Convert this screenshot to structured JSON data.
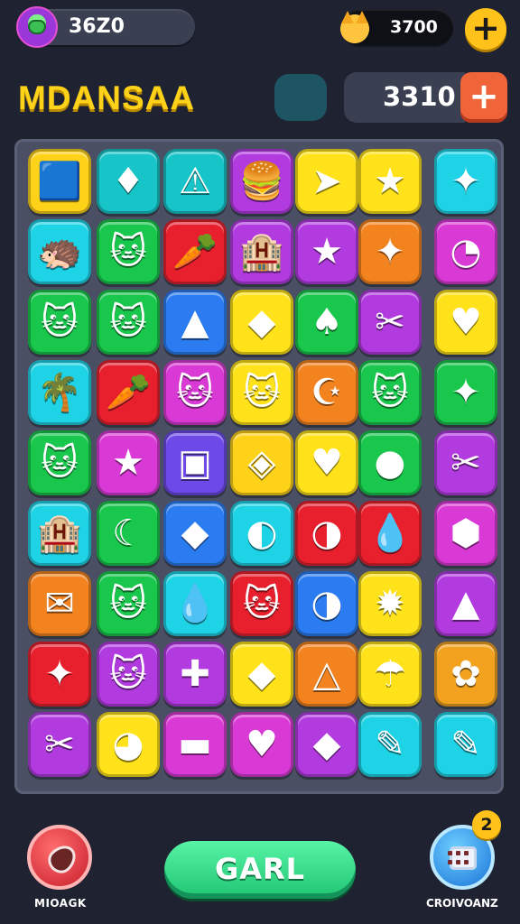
{
  "top_bar": {
    "coins": "36Z0",
    "gems": "3700",
    "avatar_icon": "green-alien-avatar-icon",
    "currency_icon": "cat-coin-icon",
    "add_label": "+"
  },
  "header": {
    "title": "MDANSAA",
    "score": "3310",
    "add_label": "+"
  },
  "board": {
    "rows": [
      [
        {
          "icon": "🟦",
          "color": "#ffd21a"
        },
        {
          "icon": "♦",
          "color": "#17c4c8"
        },
        {
          "icon": "⚠",
          "color": "#17c4c8"
        },
        {
          "icon": "🍔",
          "color": "#b23be0"
        },
        {
          "icon": "➤",
          "color": "#ffe21a"
        },
        {
          "icon": "★",
          "color": "#ffe21a"
        },
        {
          "icon": "✦",
          "color": "#1fd3e6"
        }
      ],
      [
        {
          "icon": "🦔",
          "color": "#1fd3e6"
        },
        {
          "icon": "🐱",
          "color": "#19c74d"
        },
        {
          "icon": "🥕",
          "color": "#e8202e"
        },
        {
          "icon": "🏨",
          "color": "#b23be0"
        },
        {
          "icon": "★",
          "color": "#b23be0"
        },
        {
          "icon": "✦",
          "color": "#f3831f"
        },
        {
          "icon": "◔",
          "color": "#d93ad6"
        }
      ],
      [
        {
          "icon": "🐱",
          "color": "#19c74d"
        },
        {
          "icon": "🐱",
          "color": "#19c74d"
        },
        {
          "icon": "▲",
          "color": "#2b7cf0"
        },
        {
          "icon": "◆",
          "color": "#ffe21a"
        },
        {
          "icon": "♠",
          "color": "#19c74d"
        },
        {
          "icon": "✂",
          "color": "#b23be0"
        },
        {
          "icon": "♥",
          "color": "#ffe21a"
        }
      ],
      [
        {
          "icon": "🌴",
          "color": "#1fd3e6"
        },
        {
          "icon": "🥕",
          "color": "#e8202e"
        },
        {
          "icon": "🐱",
          "color": "#d93ad6"
        },
        {
          "icon": "🐱",
          "color": "#ffe21a"
        },
        {
          "icon": "☪",
          "color": "#f3831f"
        },
        {
          "icon": "🐱",
          "color": "#19c74d"
        },
        {
          "icon": "✦",
          "color": "#19c74d"
        }
      ],
      [
        {
          "icon": "🐱",
          "color": "#19c74d"
        },
        {
          "icon": "★",
          "color": "#d93ad6"
        },
        {
          "icon": "▣",
          "color": "#6d4ae8"
        },
        {
          "icon": "◈",
          "color": "#ffd21a"
        },
        {
          "icon": "♥",
          "color": "#ffe21a"
        },
        {
          "icon": "●",
          "color": "#19c74d"
        },
        {
          "icon": "✂",
          "color": "#b23be0"
        }
      ],
      [
        {
          "icon": "🏨",
          "color": "#1fd3e6"
        },
        {
          "icon": "☾",
          "color": "#19c74d"
        },
        {
          "icon": "◆",
          "color": "#2b7cf0"
        },
        {
          "icon": "◐",
          "color": "#1fd3e6"
        },
        {
          "icon": "◑",
          "color": "#e8202e"
        },
        {
          "icon": "💧",
          "color": "#e8202e"
        },
        {
          "icon": "⬢",
          "color": "#d93ad6"
        }
      ],
      [
        {
          "icon": "✉",
          "color": "#f3831f"
        },
        {
          "icon": "🐱",
          "color": "#19c74d"
        },
        {
          "icon": "💧",
          "color": "#1fd3e6"
        },
        {
          "icon": "🐱",
          "color": "#e8202e"
        },
        {
          "icon": "◑",
          "color": "#2b7cf0"
        },
        {
          "icon": "✹",
          "color": "#ffe21a"
        },
        {
          "icon": "▲",
          "color": "#b23be0"
        }
      ],
      [
        {
          "icon": "✦",
          "color": "#e8202e"
        },
        {
          "icon": "🐱",
          "color": "#b23be0"
        },
        {
          "icon": "✚",
          "color": "#b23be0"
        },
        {
          "icon": "◆",
          "color": "#ffe21a"
        },
        {
          "icon": "△",
          "color": "#f3831f"
        },
        {
          "icon": "☂",
          "color": "#ffe21a"
        },
        {
          "icon": "✿",
          "color": "#f3a21f"
        }
      ],
      [
        {
          "icon": "✂",
          "color": "#b23be0"
        },
        {
          "icon": "◕",
          "color": "#ffe21a"
        },
        {
          "icon": "▬",
          "color": "#d93ad6"
        },
        {
          "icon": "♥",
          "color": "#d93ad6"
        },
        {
          "icon": "◆",
          "color": "#b23be0"
        },
        {
          "icon": "✎",
          "color": "#1fd3e6"
        },
        {
          "icon": "✎",
          "color": "#1fd3e6"
        }
      ]
    ]
  },
  "footer": {
    "left_label": "MIOAGK",
    "main_button": "GARL",
    "right_label": "CROIVOANZ",
    "badge": "2"
  }
}
